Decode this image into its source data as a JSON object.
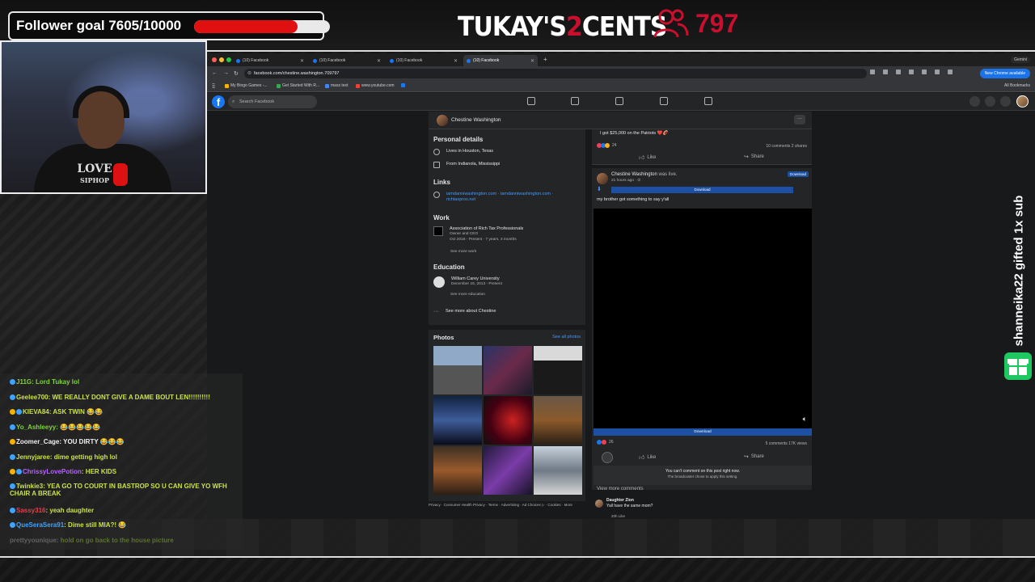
{
  "overlay": {
    "follower_goal_label": "Follower goal 7605/10000",
    "follower_current": 7605,
    "follower_target": 10000,
    "brand_logo_left": "TUKAY'S",
    "brand_logo_num": "2",
    "brand_logo_right": "CENTS",
    "viewer_count": "797",
    "gift_alert_text": "shanneika22 gifted 1x sub",
    "hoodie_text_1": "LOVE",
    "hoodie_text_2": "SIPHOP",
    "colors": {
      "accent_red": "#c8102e",
      "goal_fill": "#e01010",
      "gift_green": "#1ec760"
    }
  },
  "browser": {
    "tabs": [
      {
        "label": "(10) Facebook",
        "active": false
      },
      {
        "label": "(10) Facebook",
        "active": false
      },
      {
        "label": "(10) Facebook",
        "active": false
      },
      {
        "label": "(10) Facebook",
        "active": true
      }
    ],
    "url": "facebook.com/chestine.washington.709797",
    "gemini_label": "Gemini",
    "new_chrome_label": "New Chrome available",
    "bookmarks": [
      "My Bingo Games -...",
      "Get Started With R...",
      "mass text",
      "www.youtube.com"
    ],
    "all_bookmarks": "All Bookmarks"
  },
  "facebook": {
    "search_placeholder": "Search Facebook",
    "profile_name": "Chestine Washington",
    "personal_details_title": "Personal details",
    "lives_in": "Lives in Houston, Texas",
    "from": "From Indianola, Mississippi",
    "links_title": "Links",
    "link_1": "iamdanniwashington.com · iamdanniwashington.com ·",
    "link_2": "richtaxpros.net",
    "work_title": "Work",
    "work_org": "Association of Rich Tax Professionals",
    "work_role": "Owner and CEO",
    "work_dates": "Oct 2018 - Present · 7 years, 3 months",
    "see_more_work": "See more work",
    "education_title": "Education",
    "edu_school": "William Carey University",
    "edu_dates": "December 15, 2013 - Present",
    "see_more_education": "See more education",
    "see_more_about": "See more about Chestine",
    "photos_title": "Photos",
    "see_all_photos": "See all photos",
    "footer": "Privacy · Consumer Health Privacy · Terms · Advertising · Ad Choices ▷ · Cookies · More",
    "post_top_text": "I got $25,000 on the Patriots ❤️🏈",
    "post_top_reactions": "24",
    "post_top_counts": "10 comments  2 shares",
    "like": "Like",
    "share": "Share",
    "live_name": "Chestine Washington",
    "live_suffix": " was live.",
    "live_time": "21 hours ago · ⊙",
    "download": "Download",
    "live_caption": "my brother got something to say y'all",
    "live_reactions": "26",
    "live_counts": "5 comments  17K views",
    "cant_comment": "You can't comment on this post right now.",
    "cant_comment_sub": "The broadcaster chose to apply this setting.",
    "view_more_comments": "View more comments",
    "comment_author": "Daughter Zion",
    "comment_text": "Yall have the same mom?",
    "comment_meta": "20h   Like"
  },
  "chat": {
    "messages": [
      {
        "user": "J11G",
        "text": "Lord Tukay lol",
        "color": "#7fd33b"
      },
      {
        "user": "Geelee700",
        "text": "WE REALLY DONT GIVE A DAME BOUT LEN!!!!!!!!!!",
        "color": "#c9e24a"
      },
      {
        "user": "KIEVA84",
        "text": "ASK TWIN 😂😂",
        "color": "#c9e24a"
      },
      {
        "user": "Yo_Ashleeyy",
        "text": "😂😂😂😂😂",
        "color": "#7fd33b"
      },
      {
        "user": "Zoomer_Cage",
        "text": "YOU DIRTY 😂😂😂",
        "color": "#f0f0f0"
      },
      {
        "user": "Jennyjaree",
        "text": "dime getting high lol",
        "color": "#c9e24a"
      },
      {
        "user": "ChrissyLovePotion",
        "text": "HER KIDS",
        "color": "#b562ff"
      },
      {
        "user": "Twinkie3",
        "text": "YEA GO TO COURT IN BASTROP SO U CAN GIVE YO WFH CHAIR A BREAK",
        "color": "#c9e24a"
      },
      {
        "user": "Sassy316",
        "text": "yeah daughter",
        "color": "#e0404a"
      },
      {
        "user": "QueSeraSera91",
        "text": "Dime still MIA?! 😂",
        "color": "#3ea4ff"
      },
      {
        "user": "prettyyounique",
        "text": "hold on go back to the house picture",
        "color": "#aaaaaa"
      }
    ]
  }
}
